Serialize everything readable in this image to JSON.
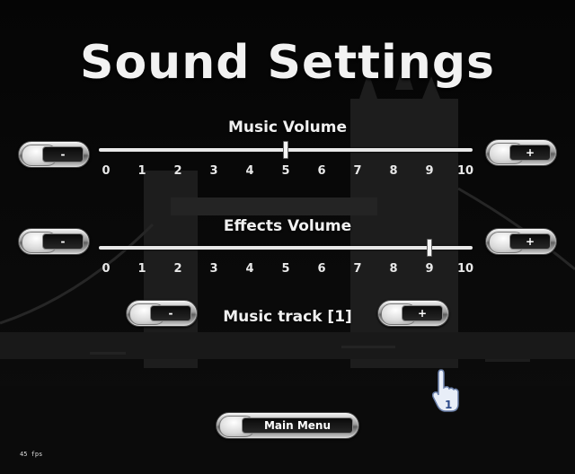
{
  "title": "Sound Settings",
  "music_volume": {
    "label": "Music Volume",
    "value": 5,
    "min": 0,
    "max": 10,
    "ticks": [
      "0",
      "1",
      "2",
      "3",
      "4",
      "5",
      "6",
      "7",
      "8",
      "9",
      "10"
    ],
    "decrease_label": "-",
    "increase_label": "+"
  },
  "effects_volume": {
    "label": "Effects Volume",
    "value": 9,
    "min": 0,
    "max": 10,
    "ticks": [
      "0",
      "1",
      "2",
      "3",
      "4",
      "5",
      "6",
      "7",
      "8",
      "9",
      "10"
    ],
    "decrease_label": "-",
    "increase_label": "+"
  },
  "music_track": {
    "label": "Music track [1]",
    "decrease_label": "-",
    "increase_label": "+"
  },
  "main_menu_label": "Main Menu",
  "fps_text": "45 fps",
  "cursor_badge": "1",
  "colors": {
    "background": "#050505",
    "text": "#f0f0f0"
  }
}
